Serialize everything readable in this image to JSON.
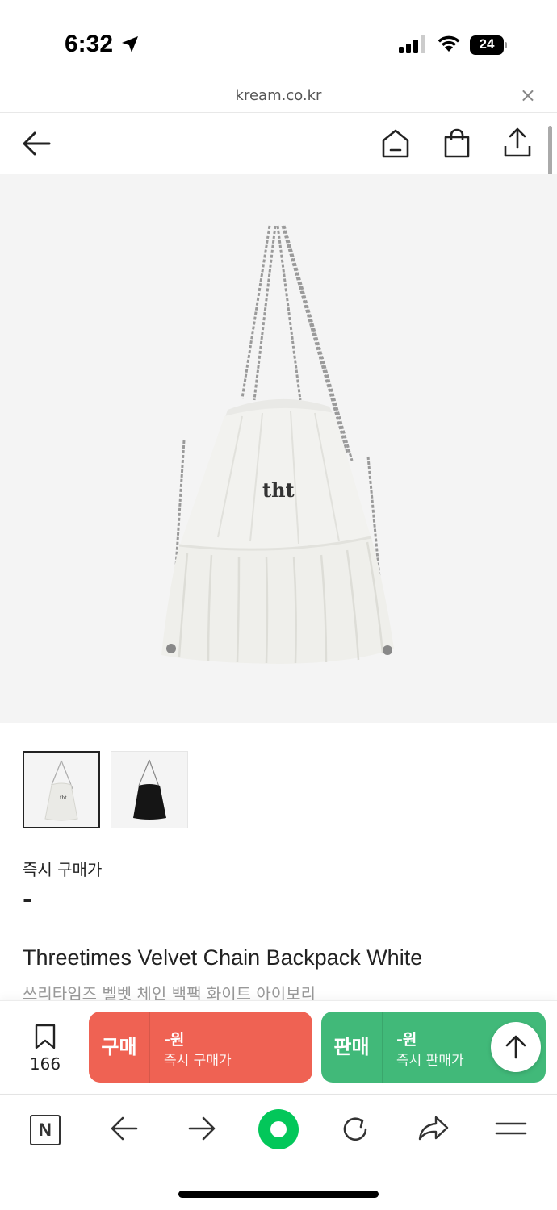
{
  "status": {
    "time": "6:32",
    "battery": "24"
  },
  "browser": {
    "url": "kream.co.kr",
    "close": "×"
  },
  "product": {
    "price_label": "즉시 구매가",
    "price_value": "-",
    "title": "Threetimes Velvet Chain Backpack White",
    "subtitle": "쓰리타임즈 벨벳 체인 백팩 화이트 아이보리",
    "bag_logo": "tht"
  },
  "actions": {
    "wish_count": "166",
    "buy": {
      "label": "구매",
      "price": "-원",
      "sub": "즉시 구매가"
    },
    "sell": {
      "label": "판매",
      "price": "-원",
      "sub": "즉시 판매가"
    }
  },
  "toolbar": {
    "n_label": "N"
  },
  "colors": {
    "buy": "#ef6253",
    "sell": "#41b979",
    "naver_green": "#03c75a",
    "hero_bg": "#f4f4f4"
  }
}
